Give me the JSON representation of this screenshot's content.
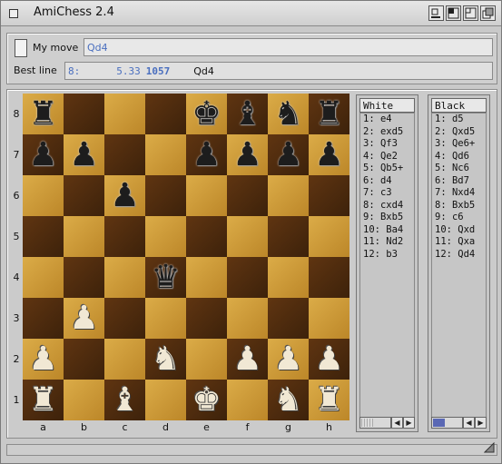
{
  "window": {
    "title": "AmiChess 2.4"
  },
  "top": {
    "my_move_label": "My move",
    "my_move_value": "Qd4",
    "best_line_label": "Best line",
    "best_line": {
      "depth": "8:",
      "score": "5.33",
      "nodes": "1057",
      "move": "Qd4"
    }
  },
  "board": {
    "files": [
      "a",
      "b",
      "c",
      "d",
      "e",
      "f",
      "g",
      "h"
    ],
    "ranks": [
      "8",
      "7",
      "6",
      "5",
      "4",
      "3",
      "2",
      "1"
    ],
    "pieces": [
      {
        "square": "a8",
        "color": "black",
        "type": "rook",
        "glyph": "♜"
      },
      {
        "square": "e8",
        "color": "black",
        "type": "king",
        "glyph": "♚"
      },
      {
        "square": "f8",
        "color": "black",
        "type": "bishop",
        "glyph": "♝"
      },
      {
        "square": "g8",
        "color": "black",
        "type": "knight",
        "glyph": "♞"
      },
      {
        "square": "h8",
        "color": "black",
        "type": "rook",
        "glyph": "♜"
      },
      {
        "square": "a7",
        "color": "black",
        "type": "pawn",
        "glyph": "♟"
      },
      {
        "square": "b7",
        "color": "black",
        "type": "pawn",
        "glyph": "♟"
      },
      {
        "square": "e7",
        "color": "black",
        "type": "pawn",
        "glyph": "♟"
      },
      {
        "square": "f7",
        "color": "black",
        "type": "pawn",
        "glyph": "♟"
      },
      {
        "square": "g7",
        "color": "black",
        "type": "pawn",
        "glyph": "♟"
      },
      {
        "square": "h7",
        "color": "black",
        "type": "pawn",
        "glyph": "♟"
      },
      {
        "square": "c6",
        "color": "black",
        "type": "pawn",
        "glyph": "♟"
      },
      {
        "square": "d4",
        "color": "black",
        "type": "queen",
        "glyph": "♛"
      },
      {
        "square": "b3",
        "color": "white",
        "type": "pawn",
        "glyph": "♟"
      },
      {
        "square": "a2",
        "color": "white",
        "type": "pawn",
        "glyph": "♟"
      },
      {
        "square": "d2",
        "color": "white",
        "type": "knight",
        "glyph": "♞"
      },
      {
        "square": "f2",
        "color": "white",
        "type": "pawn",
        "glyph": "♟"
      },
      {
        "square": "g2",
        "color": "white",
        "type": "pawn",
        "glyph": "♟"
      },
      {
        "square": "h2",
        "color": "white",
        "type": "pawn",
        "glyph": "♟"
      },
      {
        "square": "a1",
        "color": "white",
        "type": "rook",
        "glyph": "♜"
      },
      {
        "square": "c1",
        "color": "white",
        "type": "bishop",
        "glyph": "♝"
      },
      {
        "square": "e1",
        "color": "white",
        "type": "king",
        "glyph": "♚"
      },
      {
        "square": "g1",
        "color": "white",
        "type": "knight",
        "glyph": "♞"
      },
      {
        "square": "h1",
        "color": "white",
        "type": "rook",
        "glyph": "♜"
      }
    ]
  },
  "white_moves": {
    "header": "White",
    "moves": [
      "1: e4",
      "2: exd5",
      "3: Qf3",
      "4: Qe2",
      "5: Qb5+",
      "6: d4",
      "7: c3",
      "8: cxd4",
      "9: Bxb5",
      "10: Ba4",
      "11: Nd2",
      "12: b3"
    ]
  },
  "black_moves": {
    "header": "Black",
    "moves": [
      "1: d5",
      "2: Qxd5",
      "3: Qe6+",
      "4: Qd6",
      "5: Nc6",
      "6: Bd7",
      "7: Nxd4",
      "8: Bxb5",
      "9: c6",
      "10: Qxd",
      "11: Qxa",
      "12: Qd4"
    ]
  },
  "scroll": {
    "white_thumb_fraction": 0.4,
    "black_thumb_fraction": 0.4
  },
  "colors": {
    "light_square": "#c8922e",
    "dark_square": "#4a2a0d",
    "accent_text": "#4a6fbf"
  }
}
